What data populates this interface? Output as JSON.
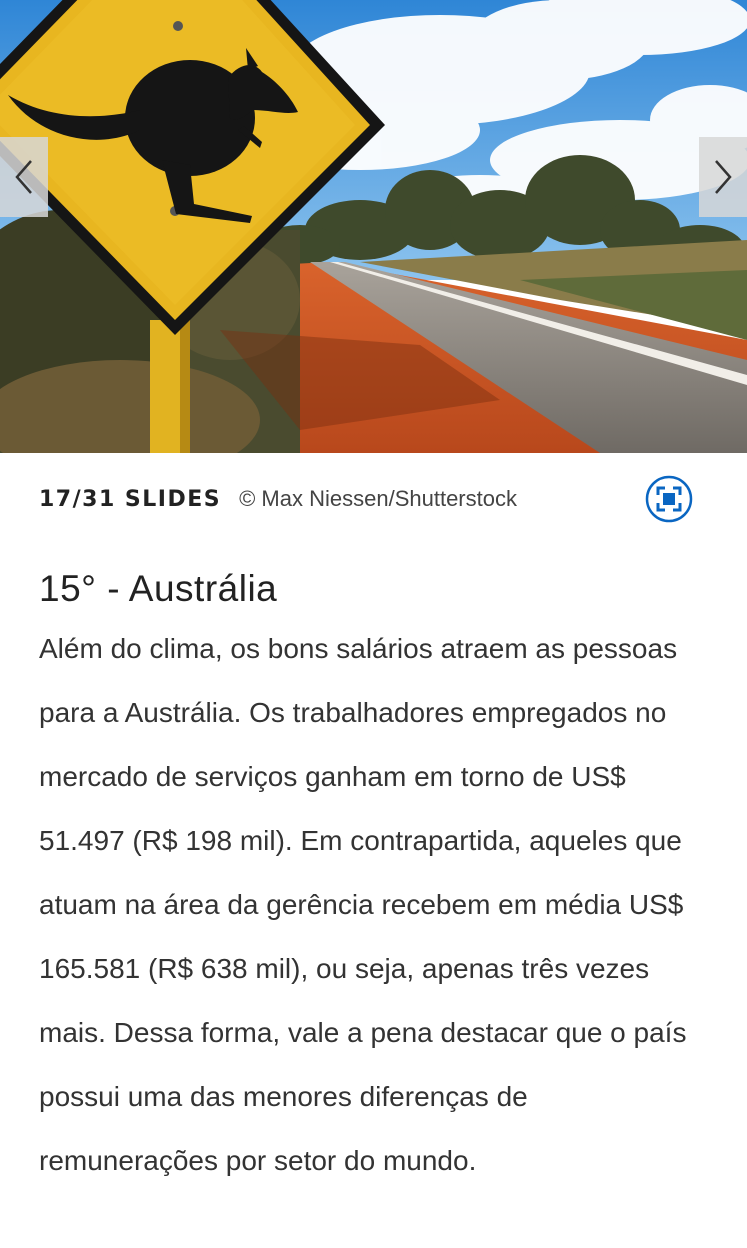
{
  "slideshow": {
    "counter": "17/31 SLIDES",
    "credit": "© Max Niessen/Shutterstock",
    "accent_color": "#0a66c2"
  },
  "hero": {
    "subject": "kangaroo warning road sign beside an outback road"
  },
  "nav": {
    "prev_icon": "chevron-left-icon",
    "next_icon": "chevron-right-icon"
  },
  "article": {
    "title": "15° - Austrália",
    "body": "Além do clima, os bons salários atraem as pessoas para a Austrália. Os trabalhadores empregados no mercado de serviços ganham em torno de US$ 51.497 (R$ 198 mil). Em contrapartida, aqueles que atuam na área da gerência recebem em média US$ 165.581 (R$ 638 mil), ou seja, apenas três vezes mais. Dessa forma, vale a pena destacar que o país possui uma das menores diferenças de remunerações por setor do mundo."
  }
}
